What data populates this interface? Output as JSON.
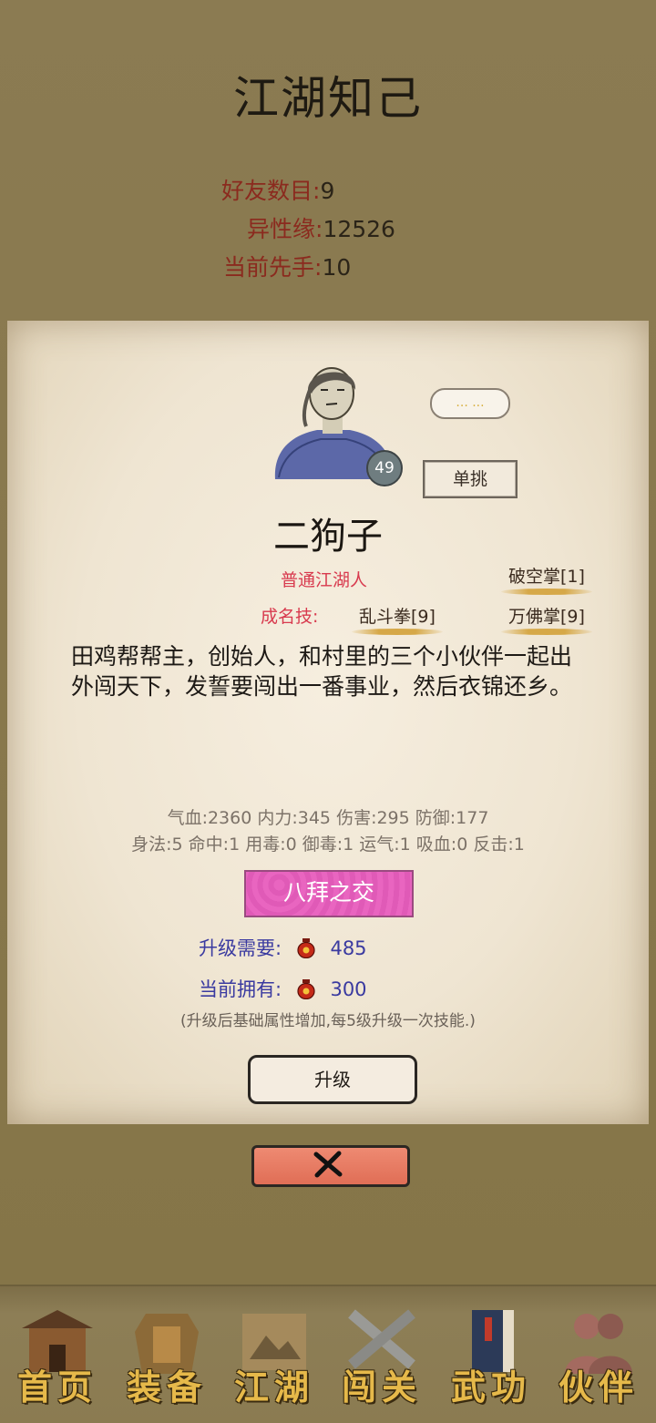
{
  "header": {
    "title": "江湖知己",
    "stats": [
      {
        "label": "好友数目:",
        "value": "9"
      },
      {
        "label": "异性缘:",
        "value": "12526"
      },
      {
        "label": "当前先手:",
        "value": "10"
      }
    ]
  },
  "character": {
    "level": "49",
    "bubble": "... ...",
    "duel_label": "单挑",
    "name": "二狗子",
    "identity": "普通江湖人",
    "fame_label": "成名技:",
    "skills": [
      "破空掌[1]",
      "乱斗拳[9]",
      "万佛掌[9]"
    ],
    "description": "田鸡帮帮主，创始人，和村里的三个小伙伴一起出外闯天下，发誓要闯出一番事业，然后衣锦还乡。",
    "attrs_line1": "气血:2360  内力:345  伤害:295  防御:177",
    "attrs_line2": "身法:5  命中:1  用毒:0  御毒:1  运气:1  吸血:0  反击:1",
    "bond": "八拜之交",
    "upgrade_need_label": "升级需要:",
    "upgrade_need_value": "485",
    "owned_label": "当前拥有:",
    "owned_value": "300",
    "note": "(升级后基础属性增加,每5级升级一次技能.)",
    "upgrade_button": "升级"
  },
  "nav": [
    {
      "label": "首页",
      "icon": "house-icon"
    },
    {
      "label": "装备",
      "icon": "armor-icon"
    },
    {
      "label": "江湖",
      "icon": "scroll-map-icon"
    },
    {
      "label": "闯关",
      "icon": "crossed-swords-icon"
    },
    {
      "label": "武功",
      "icon": "book-icon"
    },
    {
      "label": "伙伴",
      "icon": "companions-icon"
    }
  ],
  "colors": {
    "background": "#8a7a52",
    "panel": "#f3ebdc",
    "accent_red": "#d83a4e",
    "bond_pink": "#e35fbb",
    "close_button": "#e77a62",
    "nav_gold": "#e6b94a"
  }
}
